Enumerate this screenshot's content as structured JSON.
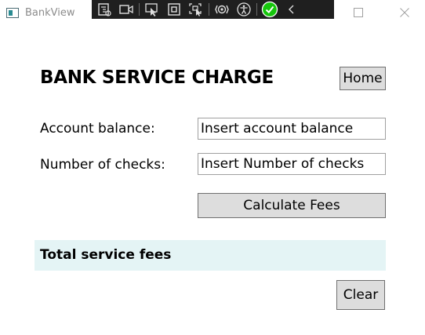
{
  "window": {
    "title": "BankView"
  },
  "icons": {
    "app": "app-window-icon",
    "toolbar": [
      "live-visual-tree-icon",
      "record-icon",
      "select-element-icon",
      "display-layout-adorners-icon",
      "track-focused-element-icon",
      "hot-reload-icon",
      "accessibility-checker-icon",
      "binding-status-ok-icon",
      "collapse-toolbar-icon"
    ],
    "minimize": "minimize-icon",
    "maximize": "maximize-icon",
    "close": "close-icon"
  },
  "colors": {
    "toolbar_bg": "#1f1f1f",
    "status_ok": "#16c60c",
    "button_bg": "#dddddd",
    "button_border": "#707070",
    "panel_bg": "#e4f4f5"
  },
  "page": {
    "heading": "BANK SERVICE CHARGE",
    "home_button": "Home",
    "account_balance_label": "Account balance:",
    "account_balance_value": "Insert account balance",
    "number_of_checks_label": "Number of checks:",
    "number_of_checks_value": "Insert Number of checks",
    "calculate_button": "Calculate Fees",
    "total_fees_label": "Total service fees",
    "clear_button": "Clear"
  }
}
